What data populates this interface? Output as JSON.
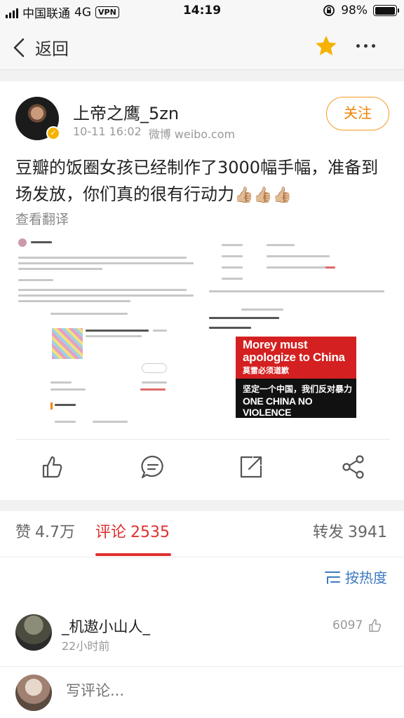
{
  "status_bar": {
    "carrier": "中国联通",
    "network": "4G",
    "vpn": "VPN",
    "time": "14:19",
    "battery_text": "98%",
    "battery_level": 0.98
  },
  "nav": {
    "back_label": "返回",
    "star_icon": "star-icon",
    "more_icon": "more-icon"
  },
  "post": {
    "username": "上帝之鹰_5zn",
    "timestamp": "10-11 16:02",
    "source": "微博 weibo.com",
    "follow_label": "关注",
    "text": "豆瓣的饭圈女孩已经制作了3000幅手幅，准备到场发放，你们真的很有行动力",
    "emoji": "👍🏼👍🏼👍🏼",
    "translate_label": "查看翻译",
    "image_right": {
      "banner_line1": "Morey must",
      "banner_line2": "apologize to China",
      "banner_sub": "莫雷必须道歉",
      "banner_cn": "坚定一个中国，我们反对暴力",
      "banner_en": "ONE CHINA NO VIOLENCE"
    }
  },
  "tabs": {
    "likes_label": "赞",
    "likes_count": "4.7万",
    "comments_label": "评论",
    "comments_count": "2535",
    "reposts_label": "转发",
    "reposts_count": "3941"
  },
  "sort": {
    "label": "按热度"
  },
  "comment": {
    "name": "_机遨小山人_",
    "time": "22小时前",
    "likes": "6097"
  },
  "compose": {
    "placeholder": "写评论..."
  },
  "colors": {
    "accent_red": "#e0302f",
    "follow_orange": "#f08300",
    "link_blue": "#3d7ac2",
    "star_yellow": "#f5b300"
  }
}
